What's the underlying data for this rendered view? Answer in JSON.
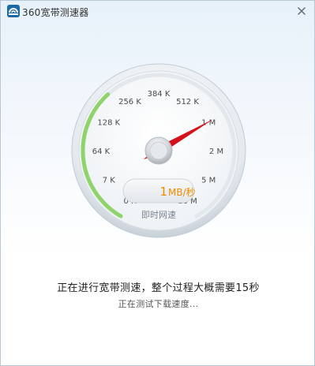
{
  "window": {
    "title": "360宽带测速器"
  },
  "gauge": {
    "tick_labels": [
      "0 K",
      "7 K",
      "64 K",
      "128 K",
      "256 K",
      "384 K",
      "512 K",
      "1 M",
      "2 M",
      "5 M",
      "10 M"
    ],
    "speed_value": "1",
    "speed_unit": "MB/秒",
    "caption": "即时网速",
    "progress_fraction": 0.36,
    "needle_label": "1 M",
    "accent_color": "#f08c00",
    "progress_color": "#8fd36a",
    "needle_color": "#d6111b"
  },
  "status": {
    "main": "正在进行宽带测速，整个过程大概需要15秒",
    "sub": "正在测试下载速度..."
  }
}
